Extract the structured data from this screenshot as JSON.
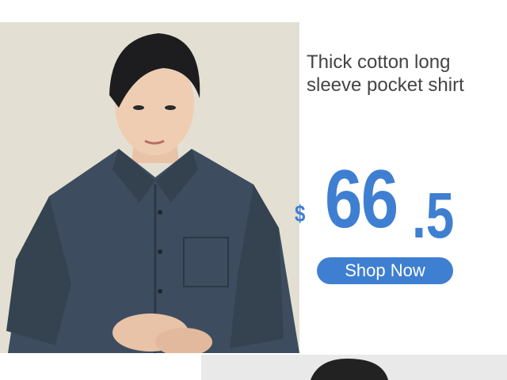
{
  "product": {
    "title_line1": "Thick cotton long",
    "title_line2": "sleeve pocket shirt",
    "currency": "$",
    "price_int": "66",
    "price_dec": ".5",
    "cta_label": "Shop Now"
  },
  "colors": {
    "accent": "#3f7fd1",
    "title_text": "#444444",
    "photo_bg": "#e3e0d3",
    "shirt": "#3d4d5f"
  }
}
